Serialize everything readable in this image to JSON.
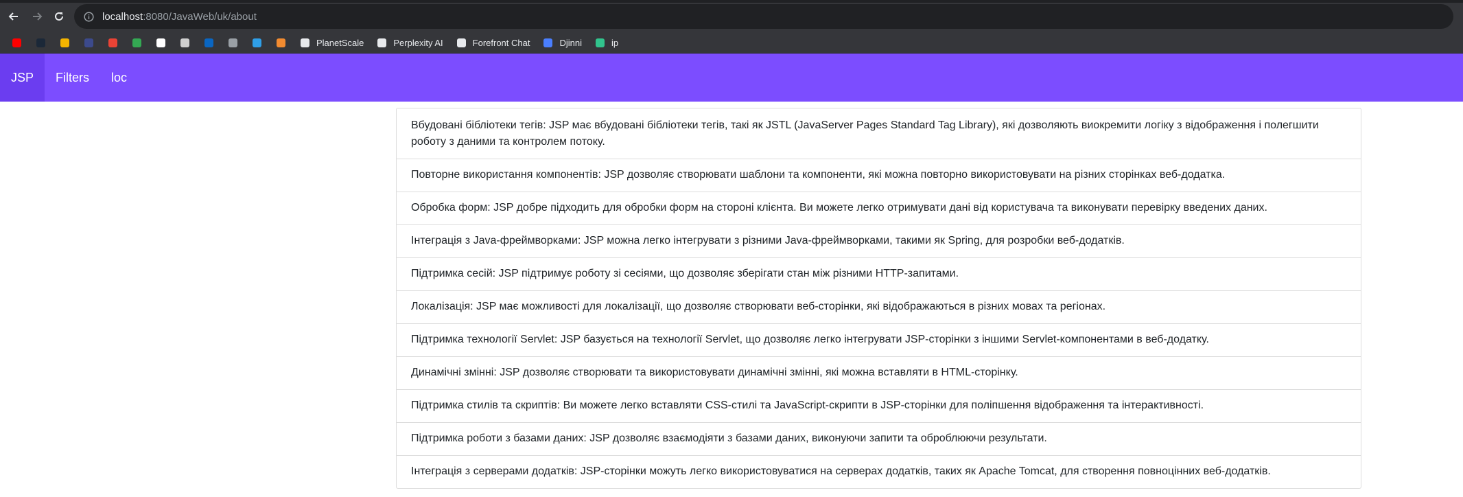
{
  "browser": {
    "url_host": "localhost",
    "url_path": ":8080/JavaWeb/uk/about"
  },
  "bookmarks": [
    {
      "icon": "youtube-icon",
      "color": "#ff0000",
      "label": ""
    },
    {
      "icon": "steam-icon",
      "color": "#1b2838",
      "label": ""
    },
    {
      "icon": "folder-icon",
      "color": "#f4b400",
      "label": ""
    },
    {
      "icon": "graduation-cap-icon",
      "color": "#3c4a8c",
      "label": ""
    },
    {
      "icon": "gmail-icon",
      "color": "#ea4335",
      "label": ""
    },
    {
      "icon": "google-drive-icon",
      "color": "#34a853",
      "label": ""
    },
    {
      "icon": "github-icon",
      "color": "#ffffff",
      "label": ""
    },
    {
      "icon": "globe-icon",
      "color": "#cfcfcf",
      "label": ""
    },
    {
      "icon": "linkedin-icon",
      "color": "#0a66c2",
      "label": ""
    },
    {
      "icon": "robot-icon",
      "color": "#9aa0a6",
      "label": ""
    },
    {
      "icon": "azure-icon",
      "color": "#2f9fe8",
      "label": ""
    },
    {
      "icon": "spiral-icon",
      "color": "#f28b30",
      "label": ""
    },
    {
      "icon": "planetscale-icon",
      "color": "#e8eaed",
      "label": "PlanetScale"
    },
    {
      "icon": "perplexity-icon",
      "color": "#e8eaed",
      "label": "Perplexity AI"
    },
    {
      "icon": "forefront-icon",
      "color": "#e8eaed",
      "label": "Forefront Chat"
    },
    {
      "icon": "djinni-icon",
      "color": "#4a7fff",
      "label": "Djinni"
    },
    {
      "icon": "ip-icon",
      "color": "#31c48d",
      "label": "ip"
    }
  ],
  "navbar": {
    "items": [
      "JSP",
      "Filters",
      "loc"
    ]
  },
  "features": [
    "Вбудовані бібліотеки тегів: JSP має вбудовані бібліотеки тегів, такі як JSTL (JavaServer Pages Standard Tag Library), які дозволяють виокремити логіку з відображення і полегшити роботу з даними та контролем потоку.",
    "Повторне використання компонентів: JSP дозволяє створювати шаблони та компоненти, які можна повторно використовувати на різних сторінках веб-додатка.",
    "Обробка форм: JSP добре підходить для обробки форм на стороні клієнта. Ви можете легко отримувати дані від користувача та виконувати перевірку введених даних.",
    "Інтеграція з Java-фреймворками: JSP можна легко інтегрувати з різними Java-фреймворками, такими як Spring, для розробки веб-додатків.",
    "Підтримка сесій: JSP підтримує роботу зі сесіями, що дозволяє зберігати стан між різними HTTP-запитами.",
    "Локалізація: JSP має можливості для локалізації, що дозволяє створювати веб-сторінки, які відображаються в різних мовах та регіонах.",
    "Підтримка технології Servlet: JSP базується на технології Servlet, що дозволяє легко інтегрувати JSP-сторінки з іншими Servlet-компонентами в веб-додатку.",
    "Динамічні змінні: JSP дозволяє створювати та використовувати динамічні змінні, які можна вставляти в HTML-сторінку.",
    "Підтримка стилів та скриптів: Ви можете легко вставляти CSS-стилі та JavaScript-скрипти в JSP-сторінки для поліпшення відображення та інтерактивності.",
    "Підтримка роботи з базами даних: JSP дозволяє взаємодіяти з базами даних, виконуючи запити та оброблюючи результати.",
    "Інтеграція з серверами додатків: JSP-сторінки можуть легко використовуватися на серверах додатків, таких як Apache Tomcat, для створення повноцінних веб-додатків."
  ],
  "colors": {
    "navbar": "#7c4dff",
    "navbar_active": "#6b3df0",
    "chrome": "#35363a"
  }
}
